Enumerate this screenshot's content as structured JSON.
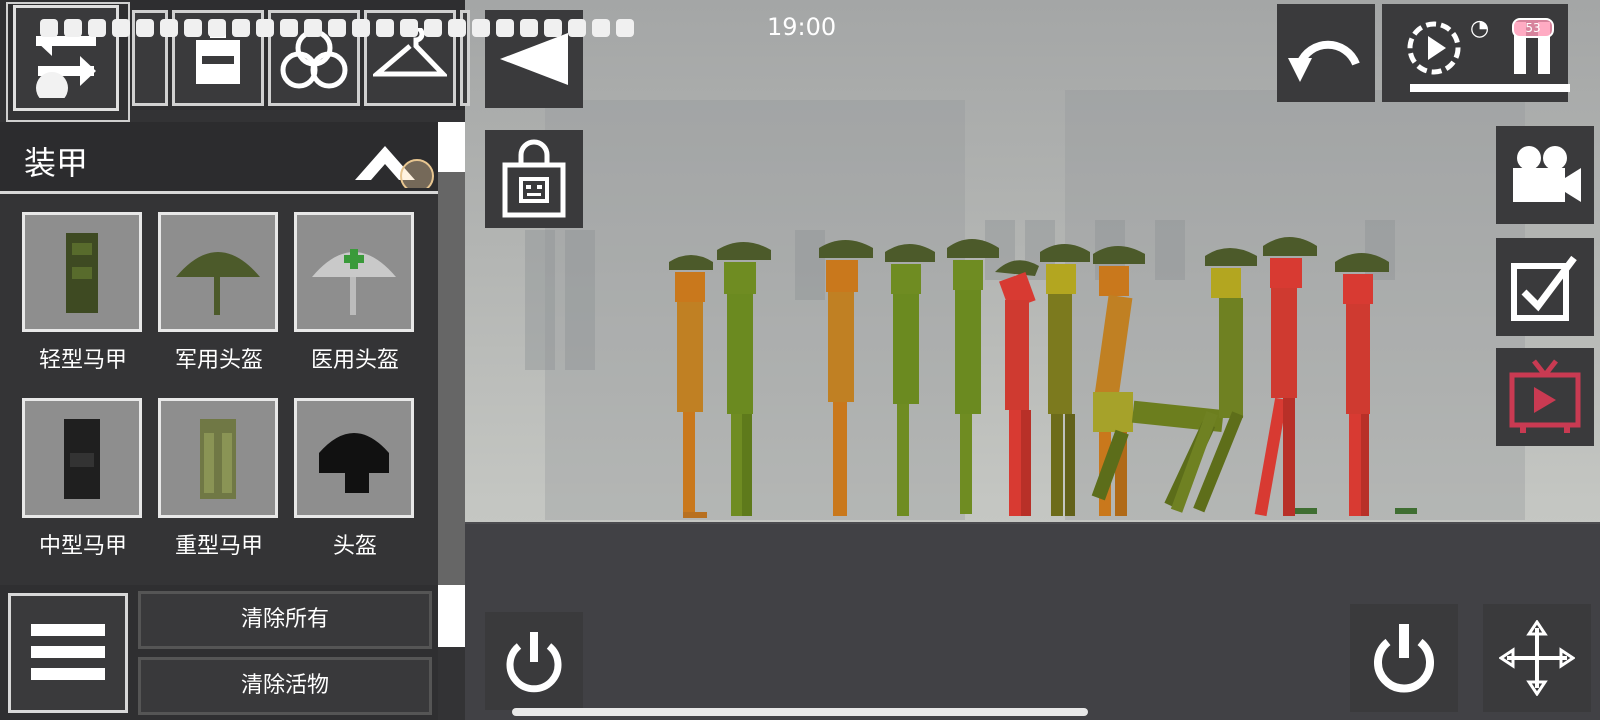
{
  "status_bar": {
    "time": "19:00",
    "battery": "53",
    "wifi_icon": "wifi-icon"
  },
  "panel": {
    "category_title": "装甲",
    "items": [
      {
        "label": "轻型马甲",
        "icon": "light-vest-icon"
      },
      {
        "label": "军用头盔",
        "icon": "military-helmet-icon"
      },
      {
        "label": "医用头盔",
        "icon": "medical-helmet-icon"
      },
      {
        "label": "中型马甲",
        "icon": "medium-vest-icon"
      },
      {
        "label": "重型马甲",
        "icon": "heavy-vest-icon"
      },
      {
        "label": "头盔",
        "icon": "helmet-icon"
      }
    ],
    "clear_all_label": "清除所有",
    "clear_living_label": "清除活物"
  },
  "colors": {
    "orange_doll": "#c9781c",
    "green_doll": "#6f8c22",
    "red_doll": "#d83a32",
    "olive_doll": "#7c7a1e",
    "helmet": "#4c5a2a",
    "panel_bg": "#333335",
    "ground": "#414145",
    "tv_accent": "#c93a52"
  }
}
